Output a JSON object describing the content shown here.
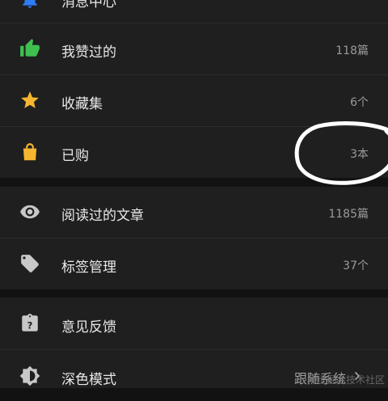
{
  "rows": [
    {
      "label": "消息中心",
      "value": "",
      "icon": "bell-icon",
      "icon_color": "#2f7cf6"
    },
    {
      "label": "我赞过的",
      "value": "118篇",
      "icon": "thumbs-up-icon",
      "icon_color": "#3fbf4f"
    },
    {
      "label": "收藏集",
      "value": "6个",
      "icon": "star-icon",
      "icon_color": "#f6b630"
    },
    {
      "label": "已购",
      "value": "3本",
      "icon": "shopping-bag-icon",
      "icon_color": "#f6b630"
    },
    {
      "label": "阅读过的文章",
      "value": "1185篇",
      "icon": "eye-icon",
      "icon_color": "#c8c8c8"
    },
    {
      "label": "标签管理",
      "value": "37个",
      "icon": "tag-icon",
      "icon_color": "#c8c8c8"
    },
    {
      "label": "意见反馈",
      "value": "",
      "icon": "feedback-clipboard-icon",
      "icon_color": "#c8c8c8"
    },
    {
      "label": "深色模式",
      "value": "跟随系统",
      "icon": "dark-mode-icon",
      "icon_color": "#c8c8c8"
    }
  ],
  "watermark": "稀土掘金技术社区",
  "colors": {
    "background": "#121212",
    "row_background": "#1f1f1f",
    "annotation": "#ffffff"
  }
}
